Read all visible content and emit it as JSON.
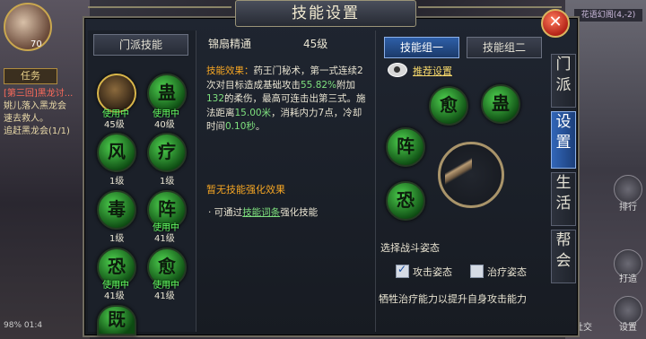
{
  "background": {
    "quest_button": "任务",
    "quest_lines": [
      "[第三回]黑龙讨...",
      "姚儿落入黑龙会",
      "速去救人。",
      "追赶黑龙会(1/1)"
    ],
    "battery": "98%",
    "time": "01:4",
    "map_label": "花语幻阁(4,-2)",
    "player_level": "70",
    "right_labels": [
      "排行",
      "打造",
      "设置"
    ],
    "social_label": "社交"
  },
  "panel": {
    "title": "技能设置",
    "close_symbol": "✕",
    "left": {
      "tab_label": "门派技能",
      "skills": [
        {
          "glyph": "",
          "in_use": "使用中",
          "level": "45级"
        },
        {
          "glyph": "蛊",
          "in_use": "使用中",
          "level": "40级"
        },
        {
          "glyph": "风",
          "in_use": "",
          "level": "1级"
        },
        {
          "glyph": "疗",
          "in_use": "",
          "level": "1级"
        },
        {
          "glyph": "毒",
          "in_use": "",
          "level": "1级"
        },
        {
          "glyph": "阵",
          "in_use": "使用中",
          "level": "41级"
        },
        {
          "glyph": "恐",
          "in_use": "使用中",
          "level": "41级"
        },
        {
          "glyph": "愈",
          "in_use": "使用中",
          "level": "41级"
        },
        {
          "glyph": "既",
          "in_use": "",
          "level": ""
        }
      ]
    },
    "middle": {
      "skill_name": "锦扇精通",
      "skill_level": "45级",
      "effect_label": "技能效果：",
      "effect_text_1": "药王门秘术，第一式连续2次对目标造成基础攻击",
      "effect_pct": "55.82%",
      "effect_text_2": "附加",
      "effect_value": "132",
      "effect_text_3": "的柔伤，最高可连击出第三式。施法距离",
      "range": "15.00米",
      "effect_text_4": "，消耗内力7点，冷却时间",
      "cooldown": "0.10秒",
      "effect_text_5": "。",
      "no_enhance": "暂无技能强化效果",
      "via_prefix": "· 可通过",
      "via_link": "技能词条",
      "via_suffix": "强化技能"
    },
    "right": {
      "group_tabs": [
        "技能组一",
        "技能组二"
      ],
      "recommend": "推荐设置",
      "slots": [
        "愈",
        "蛊",
        "阵",
        "恐"
      ],
      "stance_title": "选择战斗姿态",
      "stance_attack": "攻击姿态",
      "stance_attack_checked": true,
      "stance_heal": "治疗姿态",
      "stance_heal_checked": false,
      "stance_note": "牺牲治疗能力以提升自身攻击能力"
    },
    "side_tabs": [
      "门派",
      "设置",
      "生活",
      "帮会"
    ]
  }
}
